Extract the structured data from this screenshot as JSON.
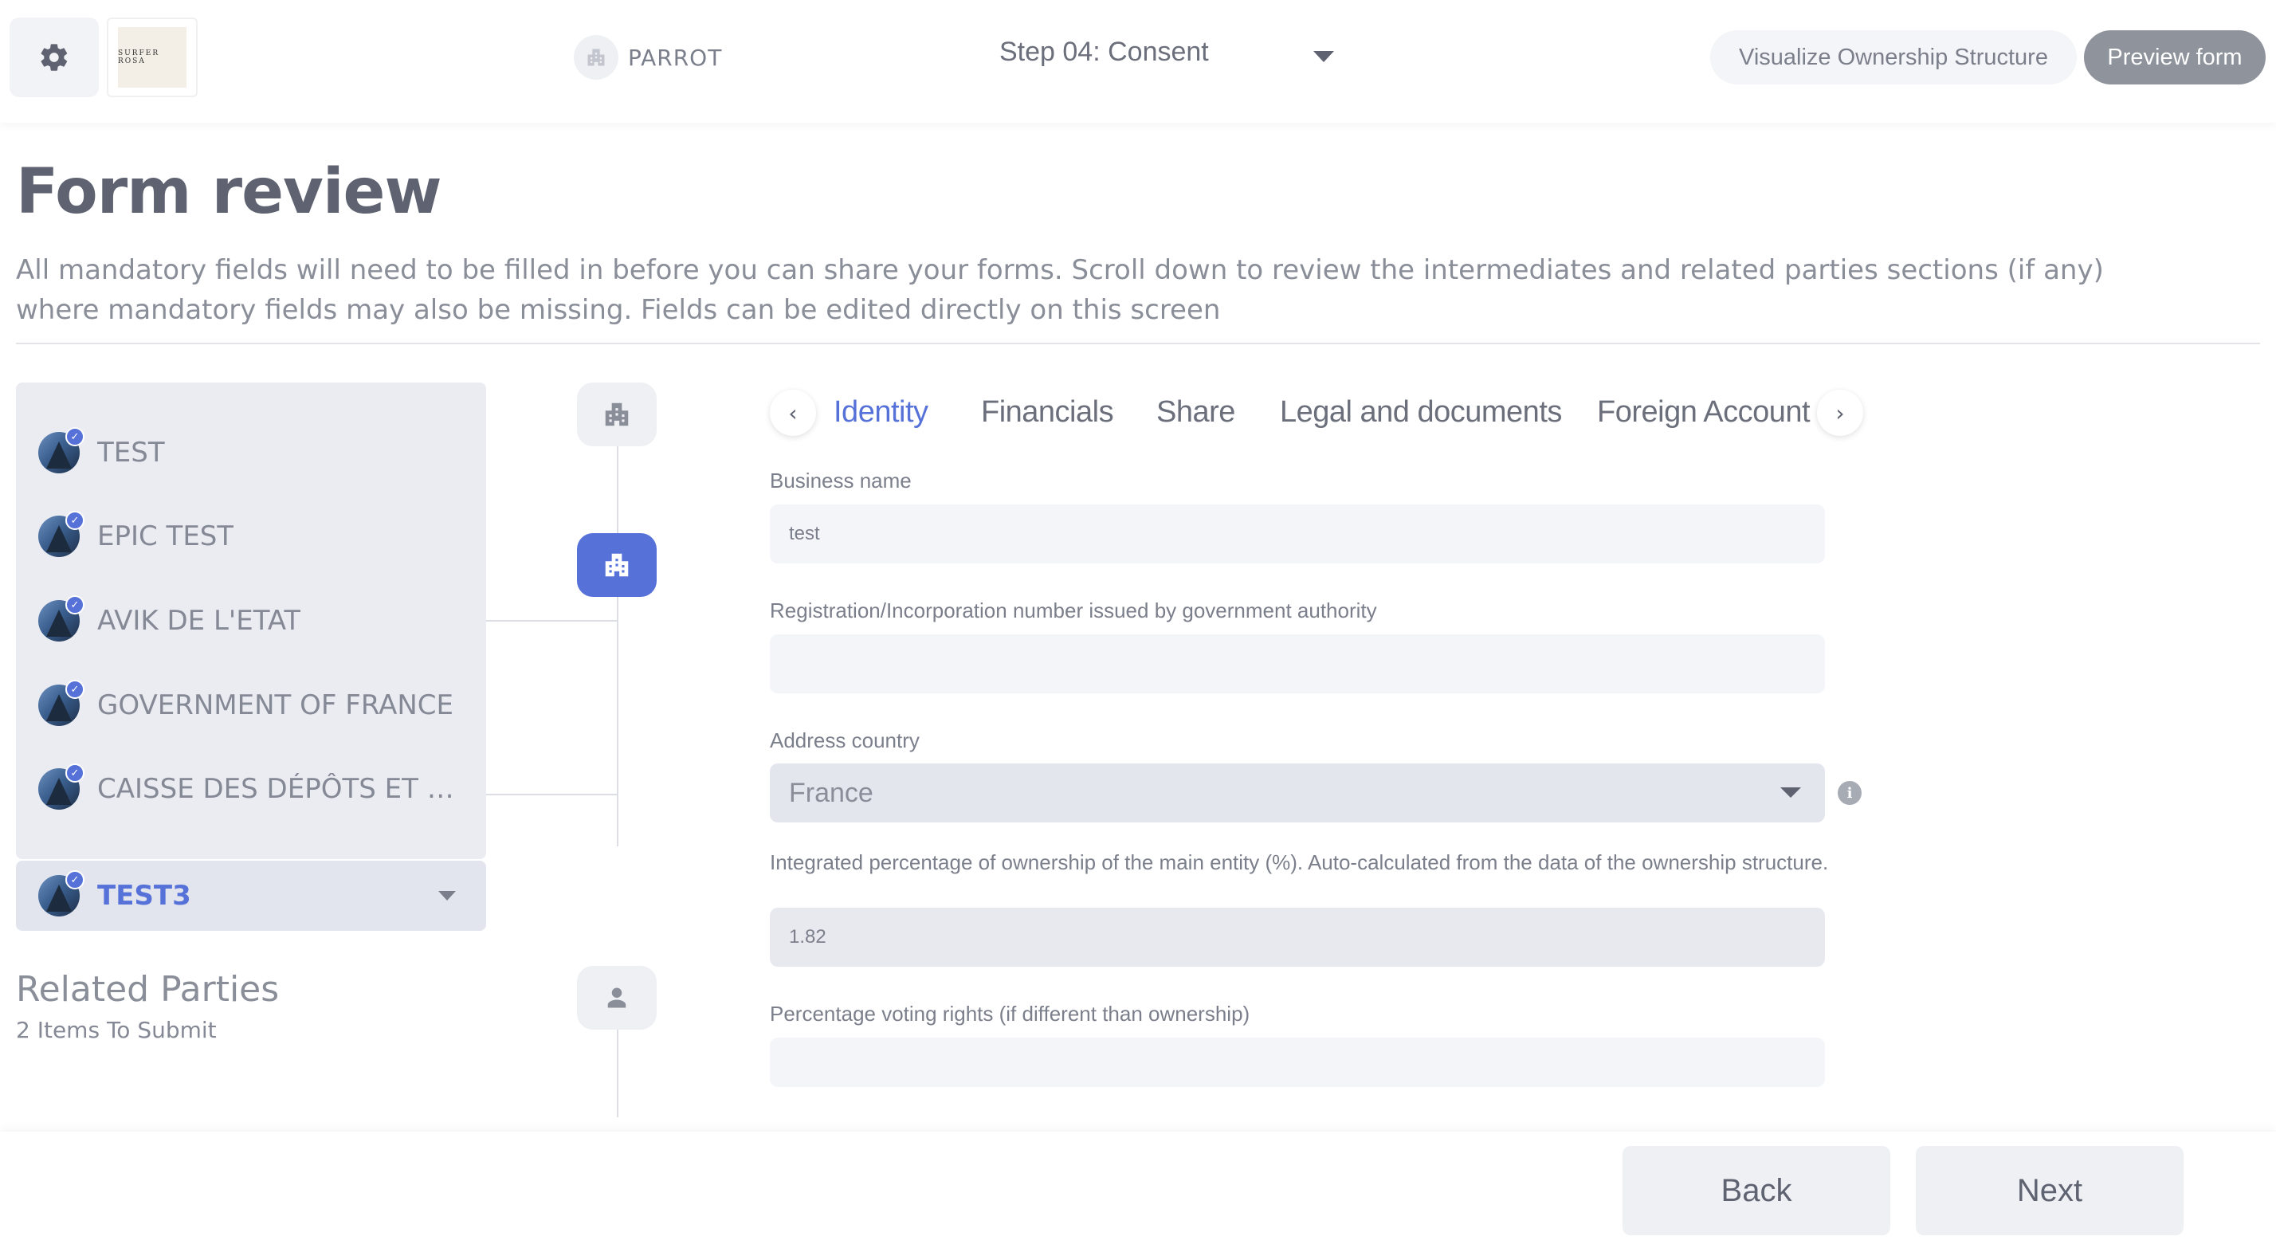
{
  "header": {
    "settings_icon": "gear-icon",
    "logo_text": "SURFER ROSA",
    "company_name": "PARROT",
    "step_label": "Step 04: Consent",
    "visualize_label": "Visualize Ownership Structure",
    "preview_label": "Preview form"
  },
  "page": {
    "title": "Form review",
    "description": "All mandatory fields will need to be filled in before you can share your forms. Scroll down to review the intermediates and related parties sections (if any) where mandatory fields may also be missing. Fields can be edited directly on this screen"
  },
  "entities": {
    "items": [
      {
        "label": "TEST"
      },
      {
        "label": "EPIC TEST"
      },
      {
        "label": "AVIK DE L'ETAT"
      },
      {
        "label": "GOVERNMENT OF FRANCE"
      },
      {
        "label": "CAISSE DES DÉPÔTS ET CO..."
      }
    ],
    "selected": "TEST3"
  },
  "related_parties": {
    "title": "Related Parties",
    "subtitle": "2 Items To Submit"
  },
  "tabs": [
    "Identity",
    "Financials",
    "Share",
    "Legal and documents",
    "Foreign Account"
  ],
  "active_tab": "Identity",
  "form": {
    "business_name": {
      "label": "Business name",
      "value": "test"
    },
    "registration_number": {
      "label": "Registration/Incorporation number issued by government authority",
      "value": ""
    },
    "address_country": {
      "label": "Address country",
      "value": "France"
    },
    "ownership_percentage": {
      "label": "Integrated percentage of ownership of the main entity (%). Auto-calculated from the data of the ownership structure.",
      "value": "1.82"
    },
    "voting_rights": {
      "label": "Percentage voting rights (if different than ownership)",
      "value": ""
    }
  },
  "footer": {
    "back_label": "Back",
    "next_label": "Next"
  },
  "colors": {
    "accent": "#5672d9",
    "preview_button": "#8e939c"
  }
}
